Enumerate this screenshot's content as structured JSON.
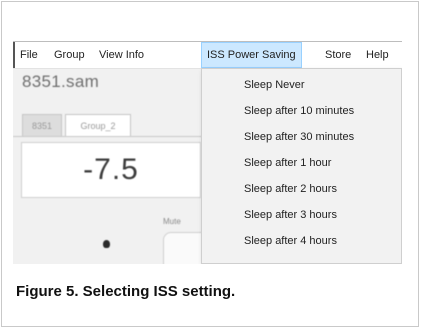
{
  "menubar": {
    "items": [
      {
        "label": "File",
        "active": false
      },
      {
        "label": "Group",
        "active": false
      },
      {
        "label": "View Info",
        "active": false
      },
      {
        "label": "ISS Power Saving",
        "active": true
      },
      {
        "label": "Store",
        "active": false
      },
      {
        "label": "Help",
        "active": false
      }
    ]
  },
  "window": {
    "file_title": "8351.sam"
  },
  "tabs": [
    {
      "label": "8351"
    },
    {
      "label": "Group_2"
    }
  ],
  "display": {
    "value": "-7.5",
    "mute_label": "Mute"
  },
  "dropdown": {
    "items": [
      "Sleep Never",
      "Sleep after 10 minutes",
      "Sleep after 30 minutes",
      "Sleep after 1 hour",
      "Sleep after 2 hours",
      "Sleep after 3 hours",
      "Sleep after 4 hours"
    ]
  },
  "caption": "Figure 5. Selecting ISS setting.",
  "colors": {
    "menu_highlight": "#cce8ff",
    "menu_highlight_border": "#99d1ff",
    "dropdown_bg": "#f2f2f2"
  }
}
